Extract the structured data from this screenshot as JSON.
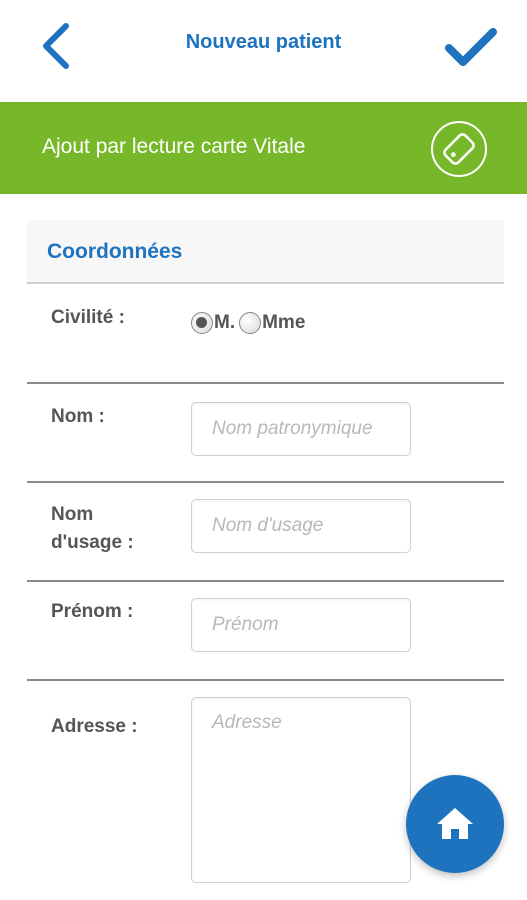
{
  "header": {
    "title": "Nouveau patient",
    "back_icon": "chevron-left-icon",
    "confirm_icon": "checkmark-icon"
  },
  "banner": {
    "label": "Ajout par lecture carte Vitale",
    "icon": "tag-card-icon",
    "color": "#76b82a"
  },
  "section": {
    "title": "Coordonnées"
  },
  "form": {
    "civilite": {
      "label": "Civilité :",
      "options": [
        "M.",
        "Mme"
      ],
      "selected": "M."
    },
    "nom": {
      "label": "Nom :",
      "placeholder": "Nom patronymique",
      "value": ""
    },
    "nom_usage": {
      "label_line1": "Nom",
      "label_line2": "d'usage :",
      "placeholder": "Nom d'usage",
      "value": ""
    },
    "prenom": {
      "label": "Prénom :",
      "placeholder": "Prénom",
      "value": ""
    },
    "adresse": {
      "label": "Adresse :",
      "placeholder": "Adresse",
      "value": ""
    }
  },
  "fab": {
    "icon": "home-icon"
  },
  "colors": {
    "accent": "#1e73be",
    "banner": "#76b82a",
    "label": "#555555"
  }
}
